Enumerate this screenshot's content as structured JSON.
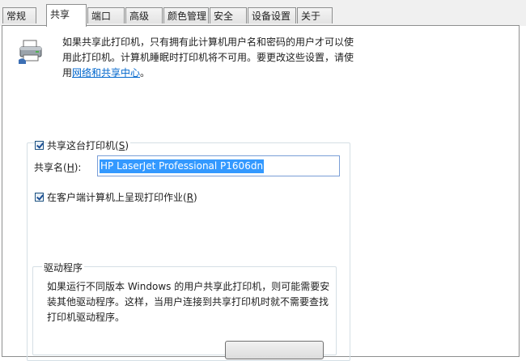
{
  "tabs": [
    {
      "label": "常规"
    },
    {
      "label": "共享"
    },
    {
      "label": "端口"
    },
    {
      "label": "高级"
    },
    {
      "label": "颜色管理"
    },
    {
      "label": "安全"
    },
    {
      "label": "设备设置"
    },
    {
      "label": "关于"
    }
  ],
  "intro": {
    "text": "如果共享此打印机，只有拥有此计算机用户名和密码的用户才可以使用此打印机。计算机睡眠时打印机将不可用。要更改这些设置，请使用",
    "link_text": "网络和共享中心",
    "suffix": "。"
  },
  "share_printer": {
    "checked": true,
    "label": "共享这台打印机(",
    "mnemonic": "S",
    "label_end": ")"
  },
  "share_name": {
    "label": "共享名(",
    "mnemonic": "H",
    "label_end": "):",
    "value": "HP LaserJet Professional P1606dn"
  },
  "render_client": {
    "checked": true,
    "label": "在客户端计算机上呈现打印作业(",
    "mnemonic": "R",
    "label_end": ")"
  },
  "drivers": {
    "title": "驱动程序",
    "text": "如果运行不同版本 Windows 的用户共享此打印机，则可能需要安装其他驱动程序。这样，当用户连接到共享打印机时就不需要查找打印机驱动程序。"
  }
}
